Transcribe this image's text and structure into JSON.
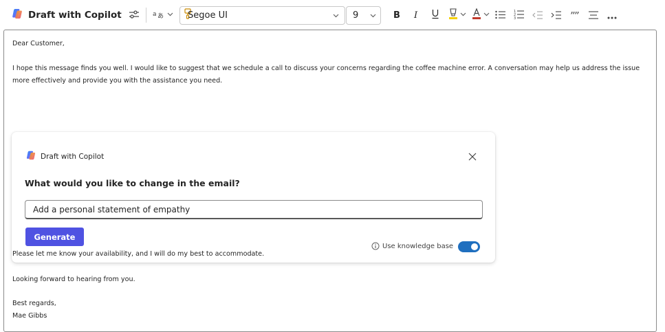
{
  "toolbar": {
    "copilot_label": "Draft with Copilot",
    "font_name": "Segoe UI",
    "font_size": "9",
    "icons": [
      "copilot-logo",
      "adjust-icon",
      "translate-icon",
      "format-painter-icon",
      "bold-icon",
      "italic-icon",
      "underline-icon",
      "highlight-icon",
      "font-color-icon",
      "bullet-list-icon",
      "numbered-list-icon",
      "decrease-indent-icon",
      "increase-indent-icon",
      "quote-icon",
      "align-icon",
      "more-icon"
    ],
    "highlight_color": "#f5d000",
    "font_color": "#c0392b"
  },
  "email": {
    "greeting": "Dear Customer,",
    "body1": "I hope this message finds you well. I would like to suggest that we schedule a call to discuss your concerns regarding the coffee machine error. A conversation may help us address the issue more effectively and provide you with the assistance you need.",
    "body2": "Please let me know your availability, and I will do my best to accommodate.",
    "body3": "Looking forward to hearing from you.",
    "closing": "Best regards,",
    "signature": "Mae Gibbs"
  },
  "copilot_card": {
    "title": "Draft with Copilot",
    "question": "What would you like to change in the email?",
    "prompt_value": "Add a personal statement of empathy",
    "generate_label": "Generate",
    "knowledge_label": "Use knowledge base",
    "knowledge_enabled": true,
    "accent_color": "#4f52e2"
  }
}
